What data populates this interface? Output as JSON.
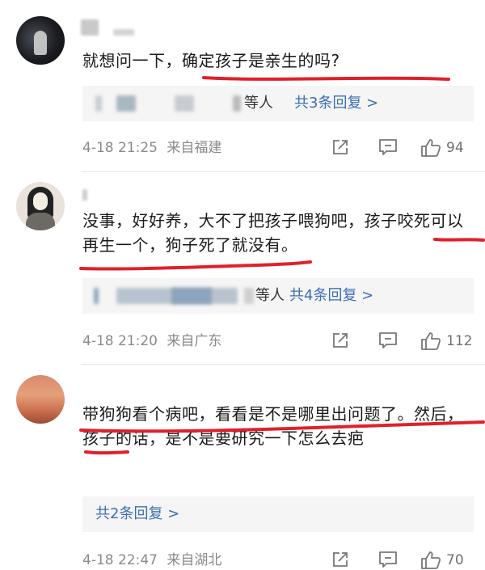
{
  "comments": [
    {
      "text": "就想问一下，确定孩子是亲生的吗?",
      "reply_suffix": "等人",
      "reply_link": "共3条回复 >",
      "time": "4-18 21:25",
      "location": "来自福建",
      "likes": "94"
    },
    {
      "text": "没事，好好养，大不了把孩子喂狗吧，孩子咬死可以再生一个，狗子死了就没有。",
      "reply_suffix": "等人",
      "reply_link": "共4条回复 >",
      "time": "4-18 21:20",
      "location": "来自广东",
      "likes": "112"
    },
    {
      "text": "带狗狗看个病吧，看看是不是哪里出问题了。然后，孩子的话，是不是要研究一下怎么去疤",
      "reply_link": "共2条回复 >",
      "time": "4-18 22:47",
      "location": "来自湖北",
      "likes": "70"
    }
  ],
  "colors": {
    "link": "#3b6fb5",
    "underline": "#e0202a",
    "meta": "#8a8a8a"
  },
  "icons": [
    "share-icon",
    "comment-icon",
    "like-icon"
  ]
}
